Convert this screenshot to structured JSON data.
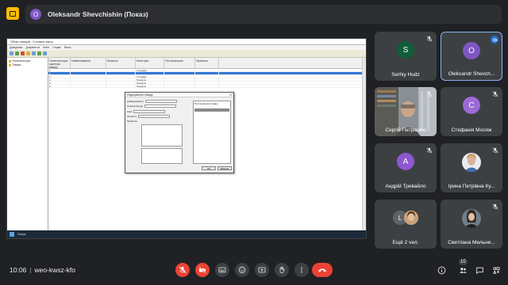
{
  "presenter": {
    "initial": "O",
    "label": "Oleksandr Shevchishin (Показ)"
  },
  "shared_screen": {
    "window_title": "Облік товарів - Головне вікно",
    "menu": [
      "Довідники",
      "Документи",
      "Звіти",
      "Сервіс",
      "Вікно"
    ],
    "tree_items": [
      "Номенклатура",
      "Товари"
    ],
    "columns": [
      "Номенклатура одиниця виміру",
      "Найменування",
      "Кількість",
      "Категорія",
      "Постачальник",
      "Примітка"
    ],
    "rows": [
      [
        "1",
        "",
        "",
        "Стандарт",
        "",
        ""
      ],
      [
        "2",
        "",
        "",
        "",
        "",
        ""
      ],
      [
        "3",
        "",
        "",
        "Стандарт",
        "",
        ""
      ],
      [
        "4",
        "",
        "",
        "Преміум",
        "",
        ""
      ],
      [
        "5",
        "",
        "",
        "Преміум",
        "",
        ""
      ],
      [
        "6",
        "",
        "",
        "Преміум",
        "",
        ""
      ]
    ],
    "dialog": {
      "title": "Редагування товару",
      "fields": [
        "Найменування",
        "Номенклатура",
        "Ціна",
        "Кількість",
        "Примітка"
      ],
      "list_header": "Постачальник товару",
      "ok": "ОК",
      "cancel": "Відміна"
    },
    "status": "Пошук"
  },
  "participants": [
    {
      "name": "Serhiy Hudz",
      "initial": "S",
      "color": "#0f5e3a",
      "muted": true
    },
    {
      "name": "Oleksandr Shevch...",
      "initial": "O",
      "color": "#7e57c2",
      "speaking": true
    },
    {
      "name": "Сергій Петрашко",
      "muted": true,
      "video": true
    },
    {
      "name": "Стефанія Мосяж",
      "initial": "C",
      "color": "#9c6ad6",
      "muted": true
    },
    {
      "name": "Андрій Тривайло",
      "initial": "А",
      "color": "#8e57d2",
      "muted": true
    },
    {
      "name": "Ірина Петрівна Ку...",
      "muted": true,
      "photo": true
    },
    {
      "name": "Ещё 2 чел.",
      "initial": "L",
      "more": true
    },
    {
      "name": "Светлана Мельни...",
      "muted": true,
      "photo": true
    }
  ],
  "meeting": {
    "time": "10:06",
    "code": "weo-kwsz-kfo"
  },
  "people_count": "10",
  "colors": {
    "background": "#202124",
    "tile": "#3c4043",
    "red": "#ea4335",
    "accent": "#8ab4f8"
  }
}
